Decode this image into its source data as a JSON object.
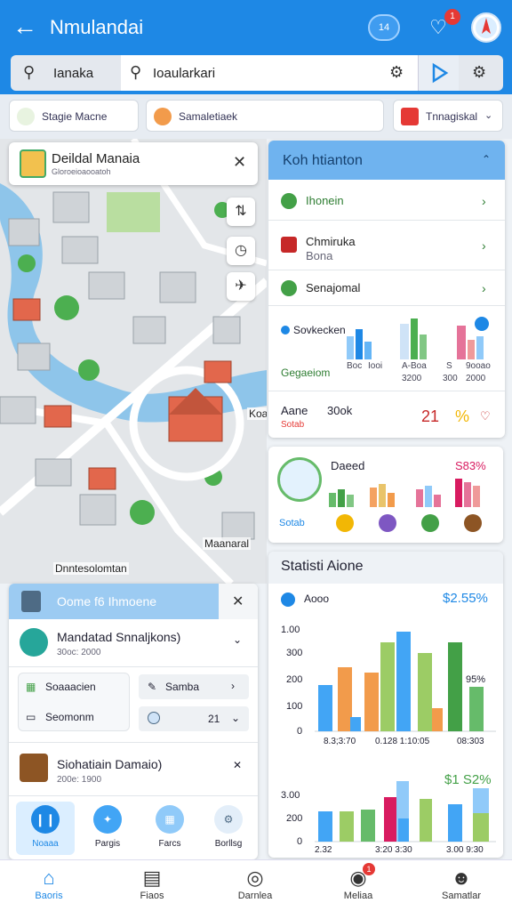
{
  "header": {
    "title": "Nmulandai",
    "chip_label": "14",
    "notif_count": "1"
  },
  "search": {
    "left_label": "Ianaka",
    "main_label": "Ioaularkari"
  },
  "filters": [
    {
      "label": "Stagie Macne",
      "color": "#2e7d32"
    },
    {
      "label": "Samaletiaek",
      "color": "#f29b4b"
    },
    {
      "label": "Tnnagiskal",
      "color": "#e53935"
    }
  ],
  "map": {
    "card_title": "Deildal Manaia",
    "card_sub": "Gloroeioaooatoh",
    "labels": [
      "Koan",
      "Maanaral",
      "Dnntesolomtan"
    ]
  },
  "panel1": {
    "title": "Koh htianton",
    "rows": [
      {
        "label": "Ihonein",
        "color": "#43a047"
      },
      {
        "label": "Chmiruka",
        "sub": "Bona",
        "color": "#c62828"
      },
      {
        "label": "Senajomal",
        "color": "#43a047"
      }
    ],
    "stat_title": "Sovkecken",
    "stat_link": "Gegaeiom",
    "stat_cols": [
      {
        "a": "Boc",
        "b": "Iooi"
      },
      {
        "a": "A-Boa",
        "b": "3200"
      },
      {
        "a": "S",
        "b": "300"
      },
      {
        "a": "9ooao",
        "b": "2000"
      }
    ],
    "footer_label": "Aane",
    "footer_value": "30ok",
    "footer_sub": "Sotab",
    "footer_num": "21",
    "footer_pct": "%"
  },
  "panel2": {
    "title": "Daeed",
    "pct": "S83%",
    "sub": "Sotab"
  },
  "panel3": {
    "title": "Statisti Aione",
    "legend": "Aooo",
    "pct1": "$2.55%",
    "pct2": "$1 S2%",
    "note": "95%",
    "chart1": {
      "yticks": [
        "1.00",
        "300",
        "200",
        "100",
        "0"
      ],
      "xticks": [
        "8.3;3:70",
        "0.128 1:10:05",
        "08:303"
      ]
    },
    "chart2": {
      "yticks": [
        "3.00",
        "200",
        "0"
      ],
      "xticks": [
        "2.32",
        "3:20 3:30",
        "3.00 9:30"
      ]
    }
  },
  "lower_panel": {
    "title": "Oome f6 Ihmoene",
    "row1_title": "Mandatad Snnaljkons)",
    "row1_sub": "30oc: 2000",
    "btn1": "Soaaacien",
    "btn2": "Samba",
    "btn3": "Seomonm",
    "btn4_val": "21",
    "row2_title": "Siohatiain Damaio)",
    "row2_sub": "200e: 1900",
    "actions": [
      "Noaaa",
      "Pargis",
      "Farcs",
      "Borllsg"
    ]
  },
  "nav": {
    "items": [
      "Baoris",
      "Fiaos",
      "Darnlea",
      "Meliaa",
      "Samatlar"
    ],
    "badge": "1"
  }
}
